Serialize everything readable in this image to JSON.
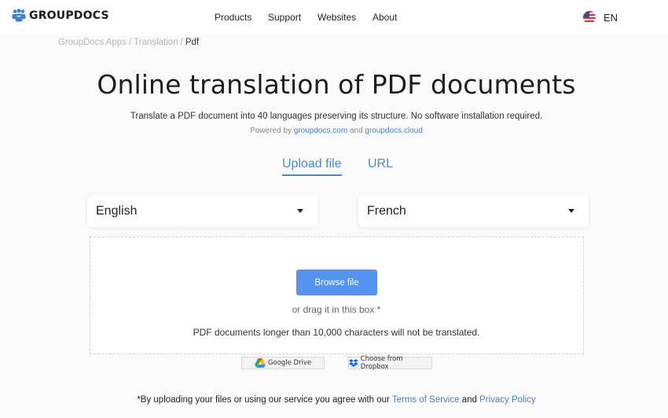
{
  "header": {
    "logo_text": "GROUPDOCS",
    "nav": [
      {
        "label": "Products"
      },
      {
        "label": "Support"
      },
      {
        "label": "Websites"
      },
      {
        "label": "About"
      }
    ],
    "language": {
      "code": "EN",
      "flag": "us-flag-icon"
    }
  },
  "breadcrumb": {
    "items": [
      "GroupDocs Apps",
      "Translation"
    ],
    "current": "Pdf",
    "separator": "/"
  },
  "main": {
    "title": "Online translation of PDF documents",
    "subtitle": "Translate a PDF document into 40 languages preserving its structure. No software installation required.",
    "powered": {
      "prefix": "Powered by",
      "link1": "groupdocs.com",
      "middle": "and",
      "link2": "groupdocs.cloud"
    },
    "tabs": [
      {
        "label": "Upload file",
        "active": true
      },
      {
        "label": "URL",
        "active": false
      }
    ],
    "source_language": "English",
    "target_language": "French",
    "upload": {
      "browse_label": "Browse file",
      "drag_text": "or drag it in this box *",
      "limit_text": "PDF documents longer than 10,000 characters will not be translated.",
      "google_drive_label": "Google Drive",
      "dropbox_label": "Choose from Dropbox"
    },
    "footer_note": {
      "prefix": "*By uploading your files or using our service you agree with our",
      "terms": "Terms of Service",
      "middle": "and",
      "privacy": "Privacy Policy"
    }
  },
  "colors": {
    "accent": "#4a8ac9",
    "button": "#5593f0",
    "link": "#4a7fc1"
  }
}
